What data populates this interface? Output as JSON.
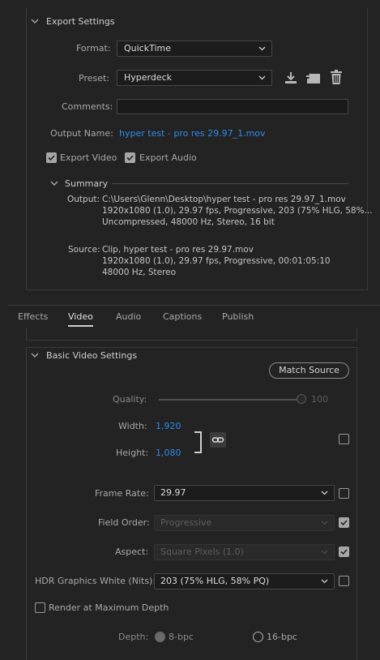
{
  "export_settings": {
    "title": "Export Settings",
    "format_label": "Format:",
    "format_value": "QuickTime",
    "preset_label": "Preset:",
    "preset_value": "Hyperdeck",
    "comments_label": "Comments:",
    "comments_value": "",
    "output_name_label": "Output Name:",
    "output_name_value": "hyper test - pro res 29.97_1.mov",
    "export_video_label": "Export Video",
    "export_video_checked": true,
    "export_audio_label": "Export Audio",
    "export_audio_checked": true
  },
  "summary": {
    "title": "Summary",
    "output_label": "Output:",
    "output_lines": [
      "C:\\Users\\Glenn\\Desktop\\hyper test - pro res 29.97_1.mov",
      "1920x1080 (1.0), 29.97 fps, Progressive, 203 (75% HLG, 58%...",
      "Uncompressed, 48000 Hz, Stereo, 16 bit"
    ],
    "source_label": "Source:",
    "source_lines": [
      "Clip, hyper test - pro res 29.97.mov",
      "1920x1080 (1.0), 29.97 fps, Progressive, 00:01:05:10",
      "48000 Hz, Stereo"
    ]
  },
  "tabs": [
    "Effects",
    "Video",
    "Audio",
    "Captions",
    "Publish"
  ],
  "active_tab": "Video",
  "basic_video": {
    "title": "Basic Video Settings",
    "match_source_label": "Match Source",
    "quality_label": "Quality:",
    "quality_value": "100",
    "width_label": "Width:",
    "width_value": "1,920",
    "height_label": "Height:",
    "height_value": "1,080",
    "frame_rate_label": "Frame Rate:",
    "frame_rate_value": "29.97",
    "field_order_label": "Field Order:",
    "field_order_value": "Progressive",
    "aspect_label": "Aspect:",
    "aspect_value": "Square Pixels (1.0)",
    "hdr_label": "HDR Graphics White (Nits):",
    "hdr_value": "203 (75% HLG, 58% PQ)",
    "render_max_depth_label": "Render at Maximum Depth",
    "depth_label": "Depth:",
    "depth_8_label": "8-bpc",
    "depth_16_label": "16-bpc"
  },
  "colors": {
    "background": "#232323",
    "link_blue": "#2d8ceb",
    "text": "#a9a9a9"
  }
}
